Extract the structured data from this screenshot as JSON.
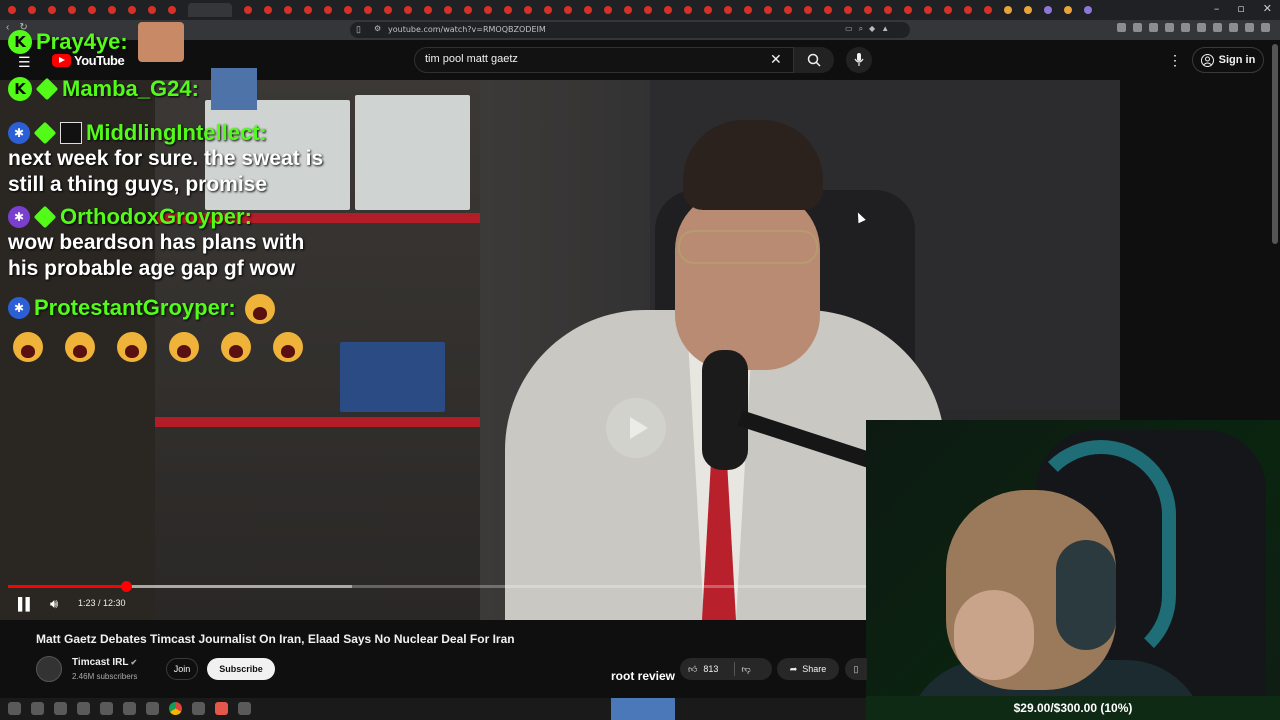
{
  "browser": {
    "url": "youtube.com/watch?v=RMOQBZODEIM",
    "window_controls": [
      "–",
      "▫",
      "✕"
    ]
  },
  "youtube": {
    "logo_text": "YouTube",
    "search_query": "tim pool matt gaetz",
    "sign_in_label": "Sign in"
  },
  "chat": {
    "messages": [
      {
        "username": "Pray4ye:",
        "text": ""
      },
      {
        "username": "Mamba_G24:",
        "text": ""
      },
      {
        "username": "MiddlingIntellect:",
        "text": "next week for sure. the sweat is still a thing guys, promise"
      },
      {
        "username": "OrthodoxGroyper:",
        "text": "wow beardson has plans with his probable age gap gf wow"
      },
      {
        "username": "ProtestantGroyper:",
        "text": ""
      }
    ]
  },
  "player": {
    "time_display": "1:23 / 12:30",
    "progress_fraction": 0.106,
    "buffered_fraction": 0.31
  },
  "video": {
    "title": "Matt Gaetz Debates Timcast Journalist On Iran, Elaad Says No Nuclear Deal For Iran",
    "channel_name": "Timcast IRL",
    "subscribers": "2.46M subscribers",
    "join_label": "Join",
    "subscribe_label": "Subscribe",
    "like_count": "813",
    "share_label": "Share"
  },
  "overlay": {
    "label": "root review",
    "goal_text": "$29.00/$300.00 (10%)"
  },
  "colors": {
    "kick_green": "#53fc18",
    "yt_red": "#ff0000",
    "background": "#0f0f0f"
  }
}
